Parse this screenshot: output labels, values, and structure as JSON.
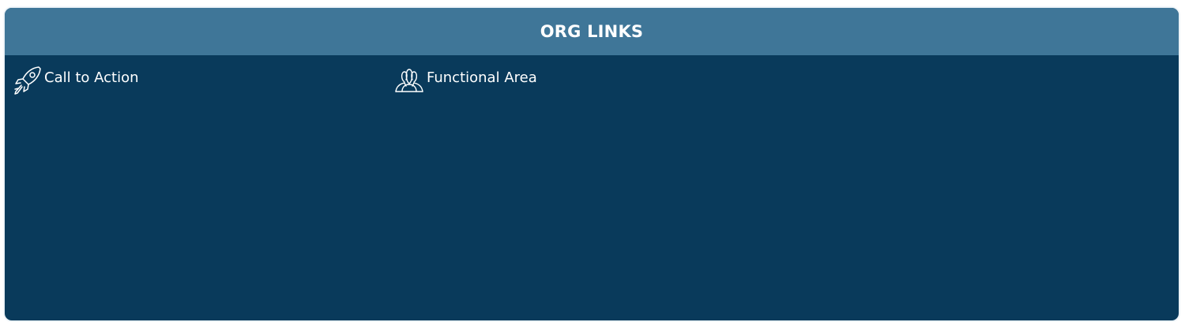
{
  "panel": {
    "title": "ORG LINKS",
    "links": [
      {
        "label": "Call to Action",
        "icon": "rocket-icon"
      },
      {
        "label": "Functional Area",
        "icon": "team-icon"
      }
    ]
  },
  "colors": {
    "header_bg": "#3f7698",
    "body_bg": "#093a5b",
    "text": "#ffffff"
  }
}
